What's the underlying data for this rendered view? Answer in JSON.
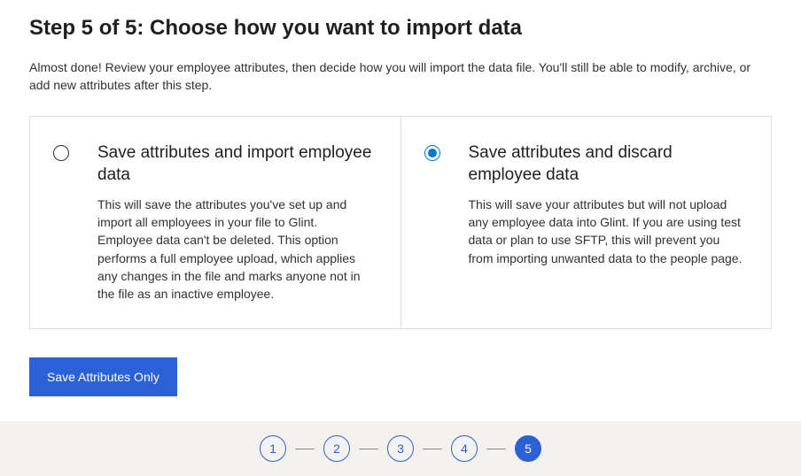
{
  "header": {
    "title": "Step 5 of 5: Choose how you want to import data",
    "description": "Almost done! Review your employee attributes, then decide how you will import the data file. You'll still be able to modify, archive, or add new attributes after this step."
  },
  "options": [
    {
      "title": "Save attributes and import employee data",
      "description": "This will save the attributes you've set up and import all employees in your file to Glint. Employee data can't be deleted. This option performs a full employee upload, which applies any changes in the file and marks anyone not in the file as an inactive employee.",
      "selected": false
    },
    {
      "title": "Save attributes and discard employee data",
      "description": "This will save your attributes but will not upload any employee data into Glint. If you are using test data or plan to use SFTP, this will prevent you from importing unwanted data to the people page.",
      "selected": true
    }
  ],
  "actions": {
    "primary_label": "Save Attributes Only"
  },
  "stepper": {
    "steps": [
      "1",
      "2",
      "3",
      "4",
      "5"
    ],
    "current": 5
  },
  "colors": {
    "primary": "#2b61d5",
    "border": "#e1dfdd",
    "stepper_bg": "#f3f2f1"
  }
}
